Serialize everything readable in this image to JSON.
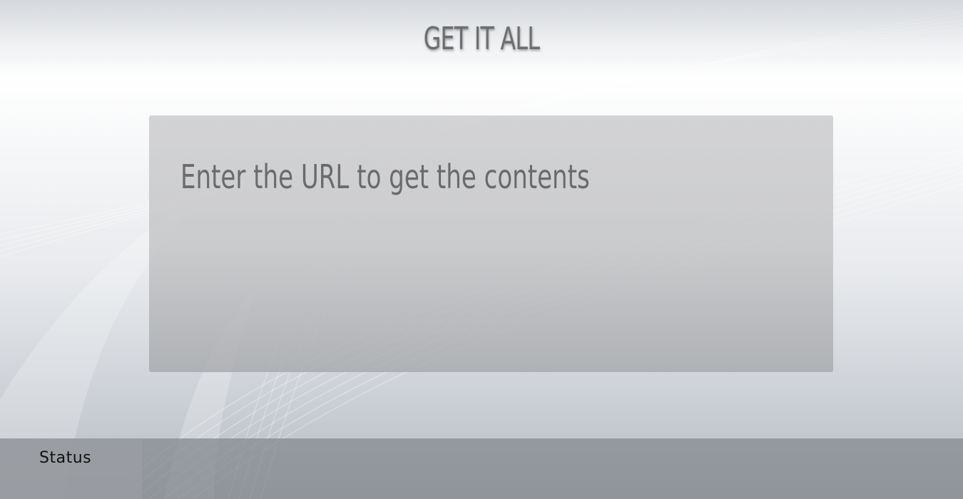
{
  "app": {
    "title": "GET IT ALL"
  },
  "url_panel": {
    "placeholder": "Enter the URL to get the contents",
    "value": ""
  },
  "status_bar": {
    "label": "Status",
    "message": ""
  },
  "colors": {
    "title_text": "#6d6e70",
    "panel_bg": "#c8c8ca",
    "status_bar_bg": "#82878e",
    "status_label_bg": "#9b9ea3"
  }
}
